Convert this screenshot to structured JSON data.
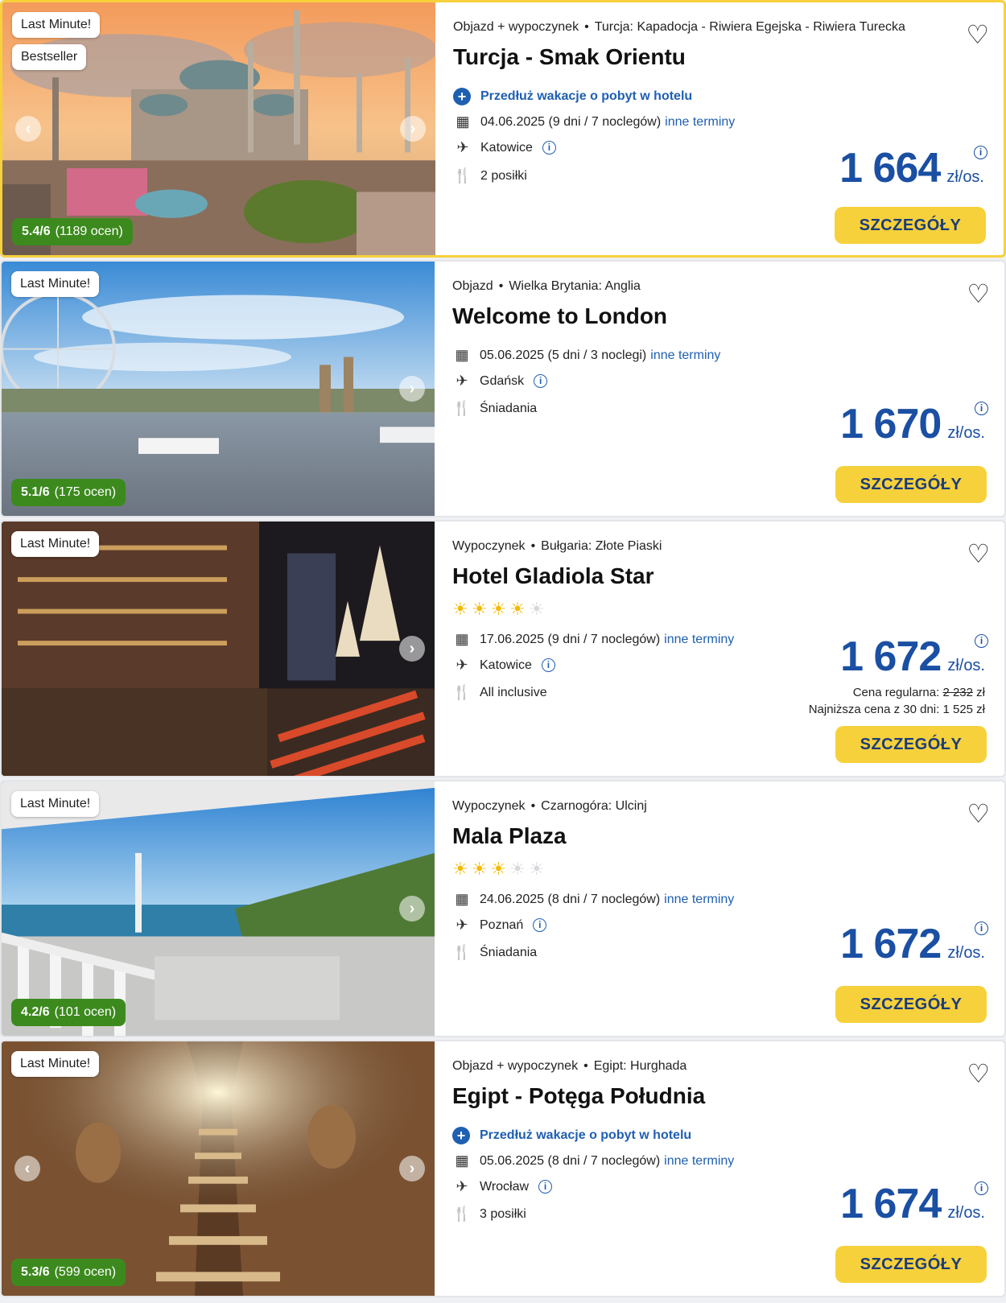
{
  "offers": [
    {
      "badges": [
        "Last Minute!",
        "Bestseller"
      ],
      "rating": "5.4/6",
      "rating_count": "(1189 ocen)",
      "type": "Objazd + wypoczynek",
      "location": "Turcja: Kapadocja - Riwiera Egejska - Riwiera Turecka",
      "title": "Turcja - Smak Orientu",
      "extend": "Przedłuż wakacje o pobyt w hotelu",
      "date": "04.06.2025 (9 dni / 7 noclegów)",
      "other_dates": "inne terminy",
      "departure": "Katowice",
      "board": "2 posiłki",
      "price": "1 664",
      "unit": "zł/os.",
      "button": "SZCZEGÓŁY"
    },
    {
      "badges": [
        "Last Minute!"
      ],
      "rating": "5.1/6",
      "rating_count": "(175 ocen)",
      "type": "Objazd",
      "location": "Wielka Brytania: Anglia",
      "title": "Welcome to London",
      "date": "05.06.2025 (5 dni / 3 noclegi)",
      "other_dates": "inne terminy",
      "departure": "Gdańsk",
      "board": "Śniadania",
      "price": "1 670",
      "unit": "zł/os.",
      "button": "SZCZEGÓŁY"
    },
    {
      "badges": [
        "Last Minute!"
      ],
      "type": "Wypoczynek",
      "location": "Bułgaria: Złote Piaski",
      "title": "Hotel Gladiola Star",
      "stars": 4,
      "date": "17.06.2025 (9 dni / 7 noclegów)",
      "other_dates": "inne terminy",
      "departure": "Katowice",
      "board": "All inclusive",
      "price": "1 672",
      "unit": "zł/os.",
      "regular_label": "Cena regularna:",
      "regular_price": "2 232",
      "regular_currency": "zł",
      "lowest": "Najniższa cena z 30 dni: 1 525 zł",
      "button": "SZCZEGÓŁY"
    },
    {
      "badges": [
        "Last Minute!"
      ],
      "rating": "4.2/6",
      "rating_count": "(101 ocen)",
      "type": "Wypoczynek",
      "location": "Czarnogóra: Ulcinj",
      "title": "Mala Plaza",
      "stars": 3,
      "date": "24.06.2025 (8 dni / 7 noclegów)",
      "other_dates": "inne terminy",
      "departure": "Poznań",
      "board": "Śniadania",
      "price": "1 672",
      "unit": "zł/os.",
      "button": "SZCZEGÓŁY"
    },
    {
      "badges": [
        "Last Minute!"
      ],
      "rating": "5.3/6",
      "rating_count": "(599 ocen)",
      "type": "Objazd + wypoczynek",
      "location": "Egipt: Hurghada",
      "title": "Egipt - Potęga Południa",
      "extend": "Przedłuż wakacje o pobyt w hotelu",
      "date": "05.06.2025 (8 dni / 7 noclegów)",
      "other_dates": "inne terminy",
      "departure": "Wrocław",
      "board": "3 posiłki",
      "price": "1 674",
      "unit": "zł/os.",
      "button": "SZCZEGÓŁY"
    }
  ],
  "colors": {
    "accent": "#f7d13b",
    "price": "#1a4fa3",
    "link": "#1f5fb1",
    "rating": "#3c8a1e"
  },
  "icons": {
    "calendar": "calendar-icon",
    "plane": "plane-icon",
    "fork": "fork-knife-icon",
    "heart": "heart-icon",
    "plus": "plus-circle-icon",
    "info": "info-icon",
    "star": "sun-star-icon"
  }
}
